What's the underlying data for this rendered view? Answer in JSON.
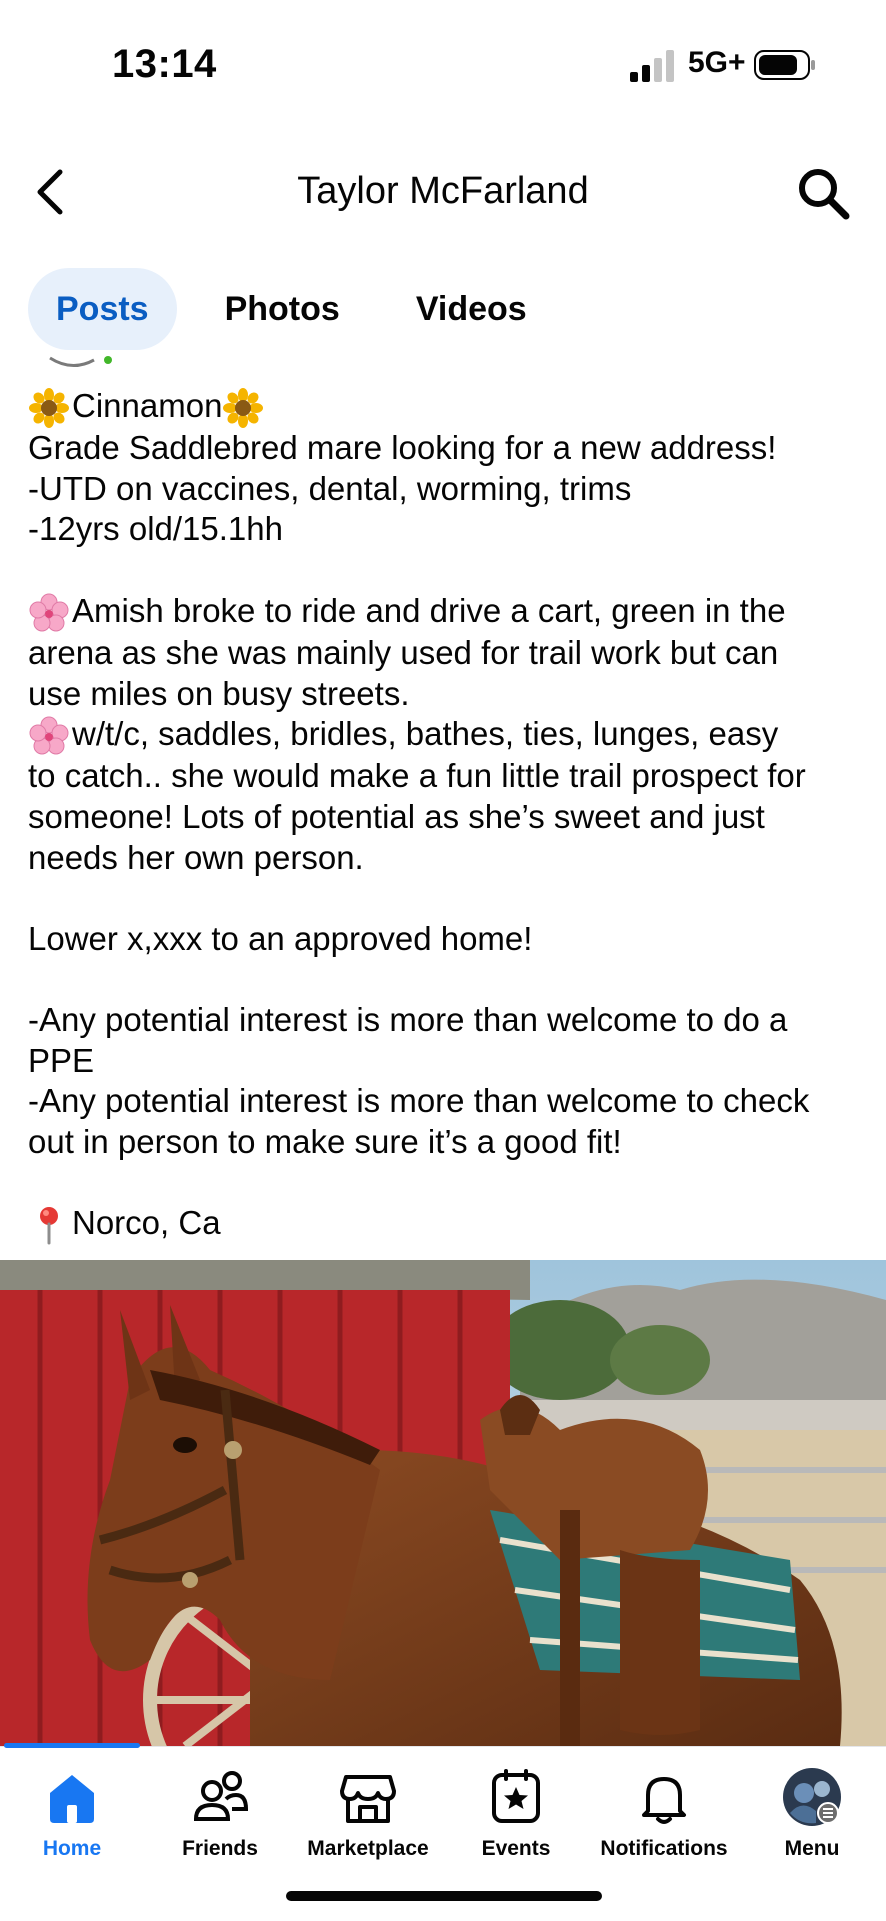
{
  "status_bar": {
    "time": "13:14",
    "network": "5G+"
  },
  "header": {
    "title": "Taylor McFarland"
  },
  "tabs": [
    {
      "label": "Posts",
      "active": true
    },
    {
      "label": "Photos",
      "active": false
    },
    {
      "label": "Videos",
      "active": false
    }
  ],
  "post": {
    "lines": [
      "Cinnamon",
      "Grade Saddlebred mare looking for a new address!",
      "-UTD on vaccines, dental, worming, trims",
      "-12yrs old/15.1hh",
      "",
      "Amish broke to ride and drive a cart, green in the",
      "arena as she was mainly used for trail work but can",
      "use miles on busy streets.",
      "w/t/c, saddles, bridles, bathes, ties, lunges, easy",
      "to catch.. she would make a fun little trail prospect for",
      "someone! Lots of potential as she’s sweet and just",
      "needs her own person.",
      "",
      "Lower x,xxx to an approved home!",
      "",
      "-Any potential interest is more than welcome to do a",
      "PPE",
      "-Any potential interest is more than welcome to check",
      "out in person to make sure it’s a good fit!",
      "",
      "Norco, Ca"
    ]
  },
  "nav": [
    {
      "label": "Home",
      "icon": "home-icon",
      "active": true
    },
    {
      "label": "Friends",
      "icon": "friends-icon",
      "active": false
    },
    {
      "label": "Marketplace",
      "icon": "marketplace-icon",
      "active": false
    },
    {
      "label": "Events",
      "icon": "events-icon",
      "active": false
    },
    {
      "label": "Notifications",
      "icon": "bell-icon",
      "active": false
    },
    {
      "label": "Menu",
      "icon": "profile-avatar",
      "active": false
    }
  ],
  "colors": {
    "accent": "#1877f2",
    "tab_active_bg": "#e7f0fb",
    "text": "#050505"
  }
}
